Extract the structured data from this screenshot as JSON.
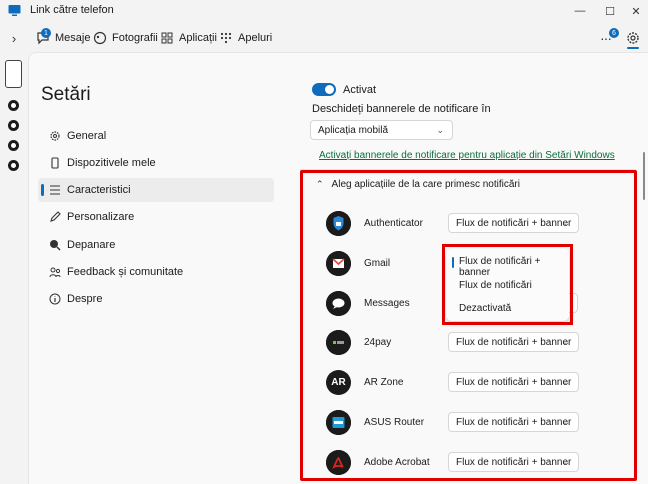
{
  "window": {
    "title": "Link către telefon",
    "controls": [
      "minimize",
      "maximize",
      "close"
    ]
  },
  "nav": {
    "tabs": [
      {
        "label": "Mesaje",
        "badge": "1"
      },
      {
        "label": "Fotografii"
      },
      {
        "label": "Aplicații"
      },
      {
        "label": "Apeluri"
      }
    ],
    "more_badge": "6"
  },
  "sidebar": {
    "title": "Setări",
    "items": [
      {
        "label": "General"
      },
      {
        "label": "Dispozitivele mele"
      },
      {
        "label": "Caracteristici",
        "active": true
      },
      {
        "label": "Personalizare"
      },
      {
        "label": "Depanare"
      },
      {
        "label": "Feedback și comunitate"
      },
      {
        "label": "Despre"
      }
    ]
  },
  "notifications": {
    "toggle_label": "Activat",
    "toggle_on": true,
    "banner_desc": "Deschideți bannerele de notificare în",
    "banner_select": "Aplicația mobilă",
    "link": "Activați bannerele de notificare pentru aplicație din Setări Windows",
    "section_header": "Aleg aplicațiile de la care primesc notificări"
  },
  "apps": [
    {
      "name": "Authenticator",
      "value": "Flux de notificări + banner"
    },
    {
      "name": "Gmail",
      "value": ""
    },
    {
      "name": "Messages",
      "value": ""
    },
    {
      "name": "24pay",
      "value": "Flux de notificări + banner"
    },
    {
      "name": "AR Zone",
      "value": "Flux de notificări + banner",
      "logo_text": "AR"
    },
    {
      "name": "ASUS Router",
      "value": "Flux de notificări + banner"
    },
    {
      "name": "Adobe Acrobat",
      "value": "Flux de notificări + banner"
    }
  ],
  "dropdown": {
    "options": [
      "Flux de notificări + banner",
      "Flux de notificări",
      "Dezactivată"
    ],
    "selected": 0
  },
  "colors": {
    "accent": "#0f6cbd",
    "highlight_red": "#e00000",
    "link": "#0a6e3a"
  }
}
